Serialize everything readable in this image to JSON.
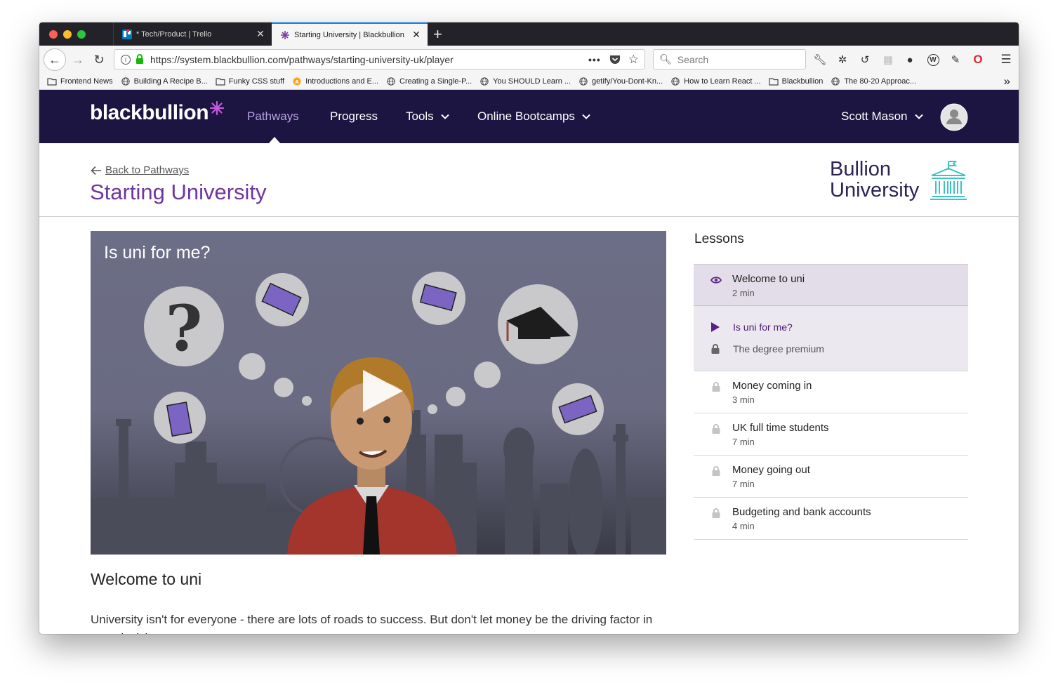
{
  "browser": {
    "tabs": [
      {
        "title": "* Tech/Product | Trello",
        "active": false
      },
      {
        "title": "Starting University | Blackbullion",
        "active": true
      }
    ],
    "url": "https://system.blackbullion.com/pathways/starting-university-uk/player",
    "search_placeholder": "Search",
    "bookmarks": [
      {
        "label": "Frontend News",
        "icon": "folder-icon"
      },
      {
        "label": "Building A Recipe B...",
        "icon": "globe-icon"
      },
      {
        "label": "Funky CSS stuff",
        "icon": "folder-icon"
      },
      {
        "label": "Introductions and E...",
        "icon": "orange-a-icon"
      },
      {
        "label": "Creating a Single-P...",
        "icon": "globe-icon"
      },
      {
        "label": "You SHOULD Learn ...",
        "icon": "globe-icon"
      },
      {
        "label": "getify/You-Dont-Kn...",
        "icon": "globe-icon"
      },
      {
        "label": "How to Learn React ...",
        "icon": "globe-icon"
      },
      {
        "label": "Blackbullion",
        "icon": "folder-icon"
      },
      {
        "label": "The 80-20 Approac...",
        "icon": "globe-icon"
      }
    ],
    "overflow": "»"
  },
  "site": {
    "logo": "blackbullion",
    "nav": [
      {
        "label": "Pathways",
        "active": true
      },
      {
        "label": "Progress"
      },
      {
        "label": "Tools"
      },
      {
        "label": "Online Bootcamps"
      }
    ],
    "user_name": "Scott Mason",
    "colors": {
      "header": "#1c1441",
      "accent": "#6f35a0",
      "nav_active": "#b9a3e3",
      "brand_teal": "#3cc3c3"
    }
  },
  "page": {
    "back_label": "Back to Pathways",
    "title": "Starting University",
    "partner_logo_line1": "Bullion",
    "partner_logo_line2": "University"
  },
  "video": {
    "title": "Is uni for me?"
  },
  "lesson_content": {
    "heading": "Welcome to uni",
    "description": "University isn't for everyone - there are lots of roads to success. But don't let money be the driving factor in your decision."
  },
  "lessons": {
    "title": "Lessons",
    "items": [
      {
        "title": "Welcome to uni",
        "duration": "2 min",
        "status": "viewing"
      },
      {
        "title": "Is uni for me?",
        "status": "playing"
      },
      {
        "title": "The degree premium",
        "status": "locked"
      },
      {
        "title": "Money coming in",
        "duration": "3 min",
        "status": "locked"
      },
      {
        "title": "UK full time students",
        "duration": "7 min",
        "status": "locked"
      },
      {
        "title": "Money going out",
        "duration": "7 min",
        "status": "locked"
      },
      {
        "title": "Budgeting and bank accounts",
        "duration": "4 min",
        "status": "locked"
      }
    ]
  }
}
